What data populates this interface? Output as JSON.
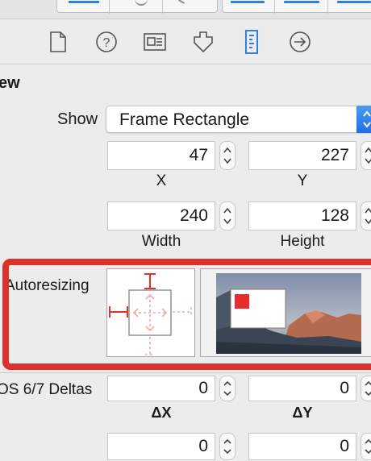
{
  "inspector": {
    "tabs": [
      {
        "name": "file-inspector",
        "icon": "document-icon"
      },
      {
        "name": "quick-help",
        "icon": "question-circle-icon"
      },
      {
        "name": "identity-inspector",
        "icon": "id-card-icon"
      },
      {
        "name": "attributes-inspector",
        "icon": "shield-arrow-icon"
      },
      {
        "name": "size-inspector",
        "icon": "ruler-icon",
        "selected": true
      },
      {
        "name": "connections-inspector",
        "icon": "arrow-circle-icon"
      }
    ],
    "accent_color": "#2f7ee6"
  },
  "view_section": {
    "title": "ew",
    "show_label": "Show",
    "show_value": "Frame Rectangle",
    "x_value": "47",
    "x_label": "X",
    "y_value": "227",
    "y_label": "Y",
    "width_value": "240",
    "width_label": "Width",
    "height_value": "128",
    "height_label": "Height",
    "autoresizing_label": "Autoresizing",
    "autoresizing": {
      "top_margin_fixed": true,
      "left_margin_fixed": true,
      "right_margin_fixed": false,
      "bottom_margin_fixed": false,
      "width_flexible": false,
      "height_flexible": false,
      "strut_color": "#e0302a"
    },
    "deltas_label": "OS 6/7 Deltas",
    "dx_value": "0",
    "dx_label": "ΔX",
    "dy_value": "0",
    "dy_label": "ΔY",
    "dw_value": "0",
    "dh_value": "0"
  },
  "highlight_color": "#e0302a"
}
